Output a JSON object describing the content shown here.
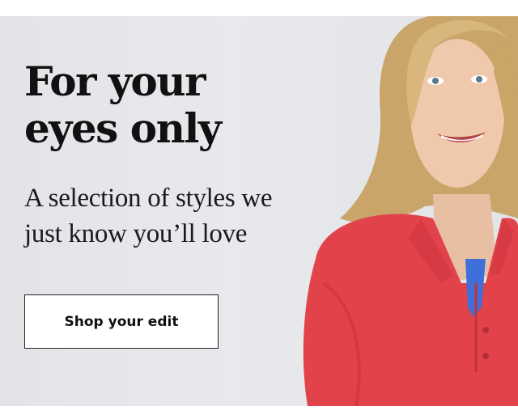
{
  "hero": {
    "headline_line1": "For your",
    "headline_line2": "eyes only",
    "subhead_line1": "A selection of styles we",
    "subhead_line2": "just know you’ll love",
    "cta_label": "Shop your edit"
  },
  "colors": {
    "background": "#e6e7ea",
    "polo_shirt": "#e2434b",
    "collar_accent": "#3f6fd8",
    "text": "#111111"
  }
}
